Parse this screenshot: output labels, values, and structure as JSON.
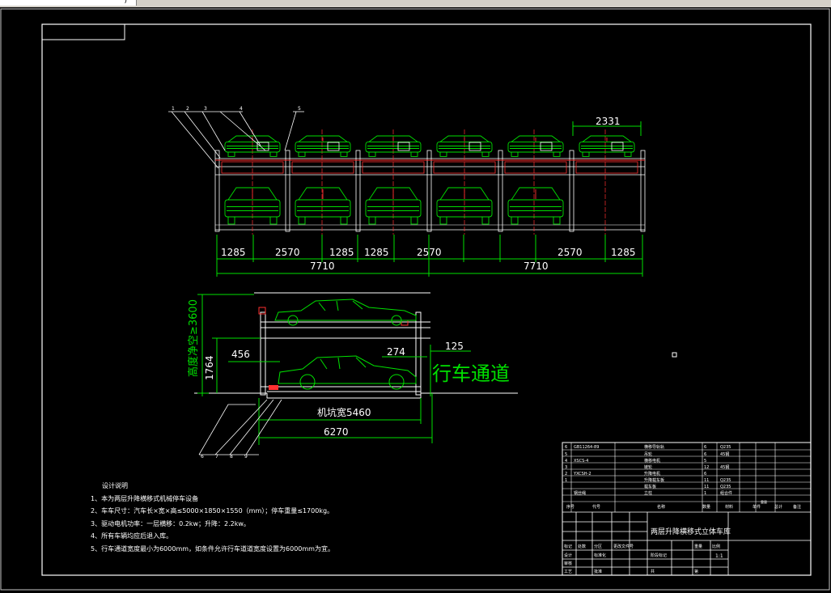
{
  "window": {
    "field_fragment": "ˋ)"
  },
  "plan_view": {
    "top_dim": "2331",
    "dims_bottom": [
      "1285",
      "2570",
      "1285",
      "1285",
      "2570",
      "2570",
      "1285"
    ],
    "totals": [
      "7710",
      "7710"
    ],
    "callouts": [
      "1",
      "2",
      "3",
      "4",
      "5"
    ]
  },
  "elevation_view": {
    "height_label": "高度净空≥3600",
    "dim_1764": "1764",
    "dim_456": "456",
    "dim_274": "274",
    "dim_125": "125",
    "lane_label": "行车通道",
    "pit_width": "机坑宽5460",
    "dim_6270": "6270",
    "callouts": [
      "6",
      "7",
      "8",
      "9"
    ]
  },
  "notes": {
    "title": "设计说明",
    "lines": [
      "1、本为两层升降横移式机械停车设备",
      "2、车车尺寸：汽车长×宽×高≤5000×1850×1550（mm）；停车重量≤1700kg。",
      "3、驱动电机功率：一层横移：0.2kw；升降：2.2kw。",
      "4、所有车辆均应后退入库。",
      "5、行车通道宽度最小为6000mm，如条件允许行车道道宽度设置为6000mm为宜。"
    ]
  },
  "parts_table": {
    "rows": [
      [
        "6",
        "GB11264-89",
        "横移导轨轨",
        "6",
        "Q235",
        "",
        ""
      ],
      [
        "5",
        "",
        "吊轮",
        "6",
        "45钢",
        "",
        ""
      ],
      [
        "4",
        "XSCS-4",
        "横移电机",
        "5",
        "",
        "",
        ""
      ],
      [
        "3",
        "",
        "链轮",
        "12",
        "45钢",
        "",
        ""
      ],
      [
        "2",
        "YXCSH-2",
        "升降电机",
        "6",
        "",
        "",
        ""
      ],
      [
        "1",
        "",
        "升降载车板",
        "11",
        "Q235",
        "",
        ""
      ],
      [
        "",
        "",
        "载车板",
        "11",
        "Q235",
        "",
        ""
      ],
      [
        "",
        "钢丝绳",
        "立柱",
        "1",
        "组合件",
        "",
        ""
      ]
    ],
    "header": [
      "序号",
      "代号",
      "名称",
      "数量",
      "材料",
      "单件",
      "总计",
      "备注"
    ],
    "header_sub": "重量"
  },
  "title_block": {
    "drawing_title": "两层升降横移式立体车库",
    "labels": [
      "标记",
      "处数",
      "分区",
      "更改文件号",
      "签名",
      "年月日",
      "设计",
      "标准化",
      "审核",
      "工艺",
      "批准",
      "阶段标记",
      "重量",
      "比例"
    ],
    "sheet_total": "共",
    "sheet_num": "第",
    "scale": "1:1"
  }
}
